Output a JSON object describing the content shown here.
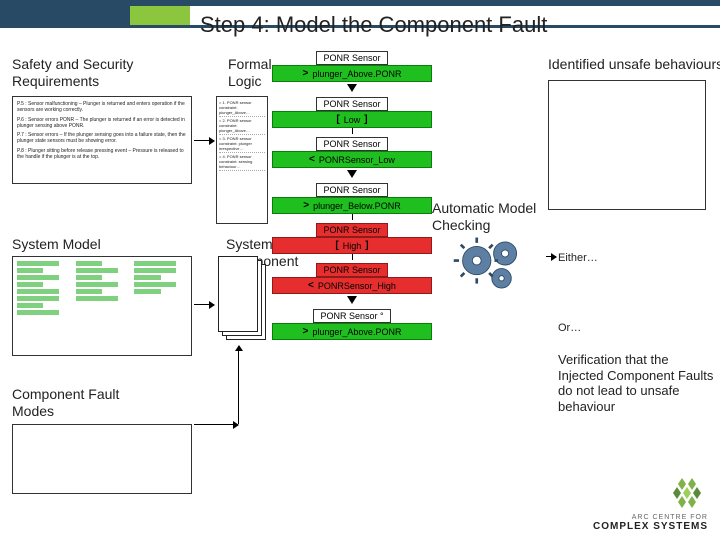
{
  "header": {
    "title": "Step 4: Model the Component Fault"
  },
  "left": {
    "safety_label": "Safety and Security Requirements",
    "safety_items": [
      "P.5 : Sensor malfunctioning – Plunger is returned and enters operation if the sensors are working correctly.",
      "P.6 : Sensor errors PONR – The plunger is returned if an error is detected in plunger sensing above PONR.",
      "P.7 : Sensor errors – If the plunger sensing goes into a failure state, then the plunger state sensors must be showing error.",
      "P.8 : Plunger sitting before release pressing event – Pressure is released to the handle if the plunger is at the top."
    ],
    "sysmodel_label": "System Model",
    "compfault_label": "Component Fault Modes"
  },
  "formal": {
    "label": "Formal Logic",
    "rows": [
      "= 1. PONR sensor constraint: plunger_Above…",
      "= 2. PONR sensor constraint: plunger_Above…",
      "= 3. PONR sensor constraint: plunger irrespective…",
      "= 4. PONR sensor constraint: sensing behaviour…"
    ]
  },
  "syscomp": {
    "label": "System + Component"
  },
  "sensors": {
    "badge": "PONR Sensor",
    "badge_alt": "PONR Sensor °",
    "rows": [
      {
        "type": "green",
        "sym": ">",
        "val": "plunger_Above.PONR"
      },
      {
        "type": "green",
        "sym": "[",
        "val": "Low",
        "sym2": "]"
      },
      {
        "type": "green",
        "sym": "<",
        "val": "PONRSensor_Low"
      },
      {
        "type": "green",
        "sym": ">",
        "val": "plunger_Below.PONR"
      },
      {
        "type": "red",
        "sym": "[",
        "val": "High",
        "sym2": "]"
      },
      {
        "type": "red",
        "sym": "<",
        "val": "PONRSensor_High"
      },
      {
        "type": "green",
        "sym": ">",
        "val": "plunger_Above.PONR"
      }
    ]
  },
  "right": {
    "identified_label": "Identified unsafe behaviours",
    "auto_label": "Automatic Model Checking",
    "either_label": "Either…",
    "or_label": "Or…",
    "verification_text": "Verification that the Injected Component Faults do not lead to unsafe behaviour"
  },
  "logo": {
    "top": "ARC CENTRE FOR",
    "bottom": "COMPLEX SYSTEMS"
  }
}
